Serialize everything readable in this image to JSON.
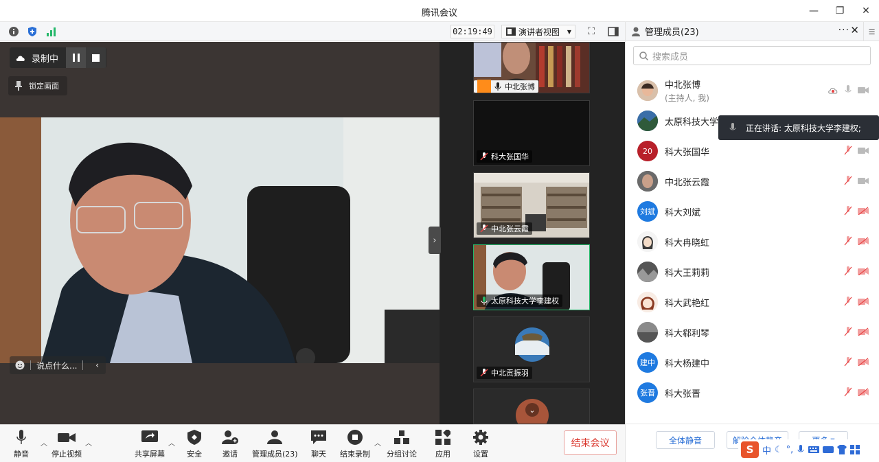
{
  "window": {
    "title": "腾讯会议"
  },
  "toolbar": {
    "timer": "02:19:49",
    "view_label": "演讲者视图"
  },
  "stage": {
    "recording_label": "录制中",
    "lock_label": "锁定画面",
    "chat_placeholder": "说点什么..."
  },
  "gallery": {
    "tiles": [
      {
        "name": "中北张博"
      },
      {
        "name": "科大张国华"
      },
      {
        "name": "中北张云霞"
      },
      {
        "name": "太原科技大学李建权"
      },
      {
        "name": "中北贡振羽"
      }
    ]
  },
  "panel": {
    "title": "管理成员(23)",
    "search_placeholder": "搜索成员",
    "speaking_prefix": "正在讲话:",
    "speaking_name": "太原科技大学李建权;",
    "members": [
      {
        "name": "中北张博",
        "role": "(主持人, 我)",
        "avatar_text": ""
      },
      {
        "name": "太原科技大学李",
        "role": "",
        "avatar_text": ""
      },
      {
        "name": "科大张国华",
        "role": "",
        "avatar_text": "20"
      },
      {
        "name": "中北张云霞",
        "role": "",
        "avatar_text": ""
      },
      {
        "name": "科大刘斌",
        "role": "",
        "avatar_text": "刘斌"
      },
      {
        "name": "科大冉晓虹",
        "role": "",
        "avatar_text": ""
      },
      {
        "name": "科大王莉莉",
        "role": "",
        "avatar_text": ""
      },
      {
        "name": "科大武艳红",
        "role": "",
        "avatar_text": ""
      },
      {
        "name": "科大郗利琴",
        "role": "",
        "avatar_text": ""
      },
      {
        "name": "科大杨建中",
        "role": "",
        "avatar_text": "建中"
      },
      {
        "name": "科大张晋",
        "role": "",
        "avatar_text": "张晋"
      }
    ],
    "footer": {
      "mute_all": "全体静音",
      "unmute_all": "解除全体静音",
      "more": "更多"
    },
    "ime": {
      "lang": "中",
      "punct": "°,"
    }
  },
  "bottombar": {
    "mute": "静音",
    "stop_video": "停止视频",
    "share_screen": "共享屏幕",
    "security": "安全",
    "invite": "邀请",
    "manage_members": "管理成员(23)",
    "chat": "聊天",
    "end_recording": "结束录制",
    "breakout": "分组讨论",
    "apps": "应用",
    "settings": "设置",
    "end_meeting": "结束会议"
  },
  "colors": {
    "accent_green": "#26b86b",
    "end_red": "#d9352b",
    "brand_blue": "#2a6fd6"
  }
}
